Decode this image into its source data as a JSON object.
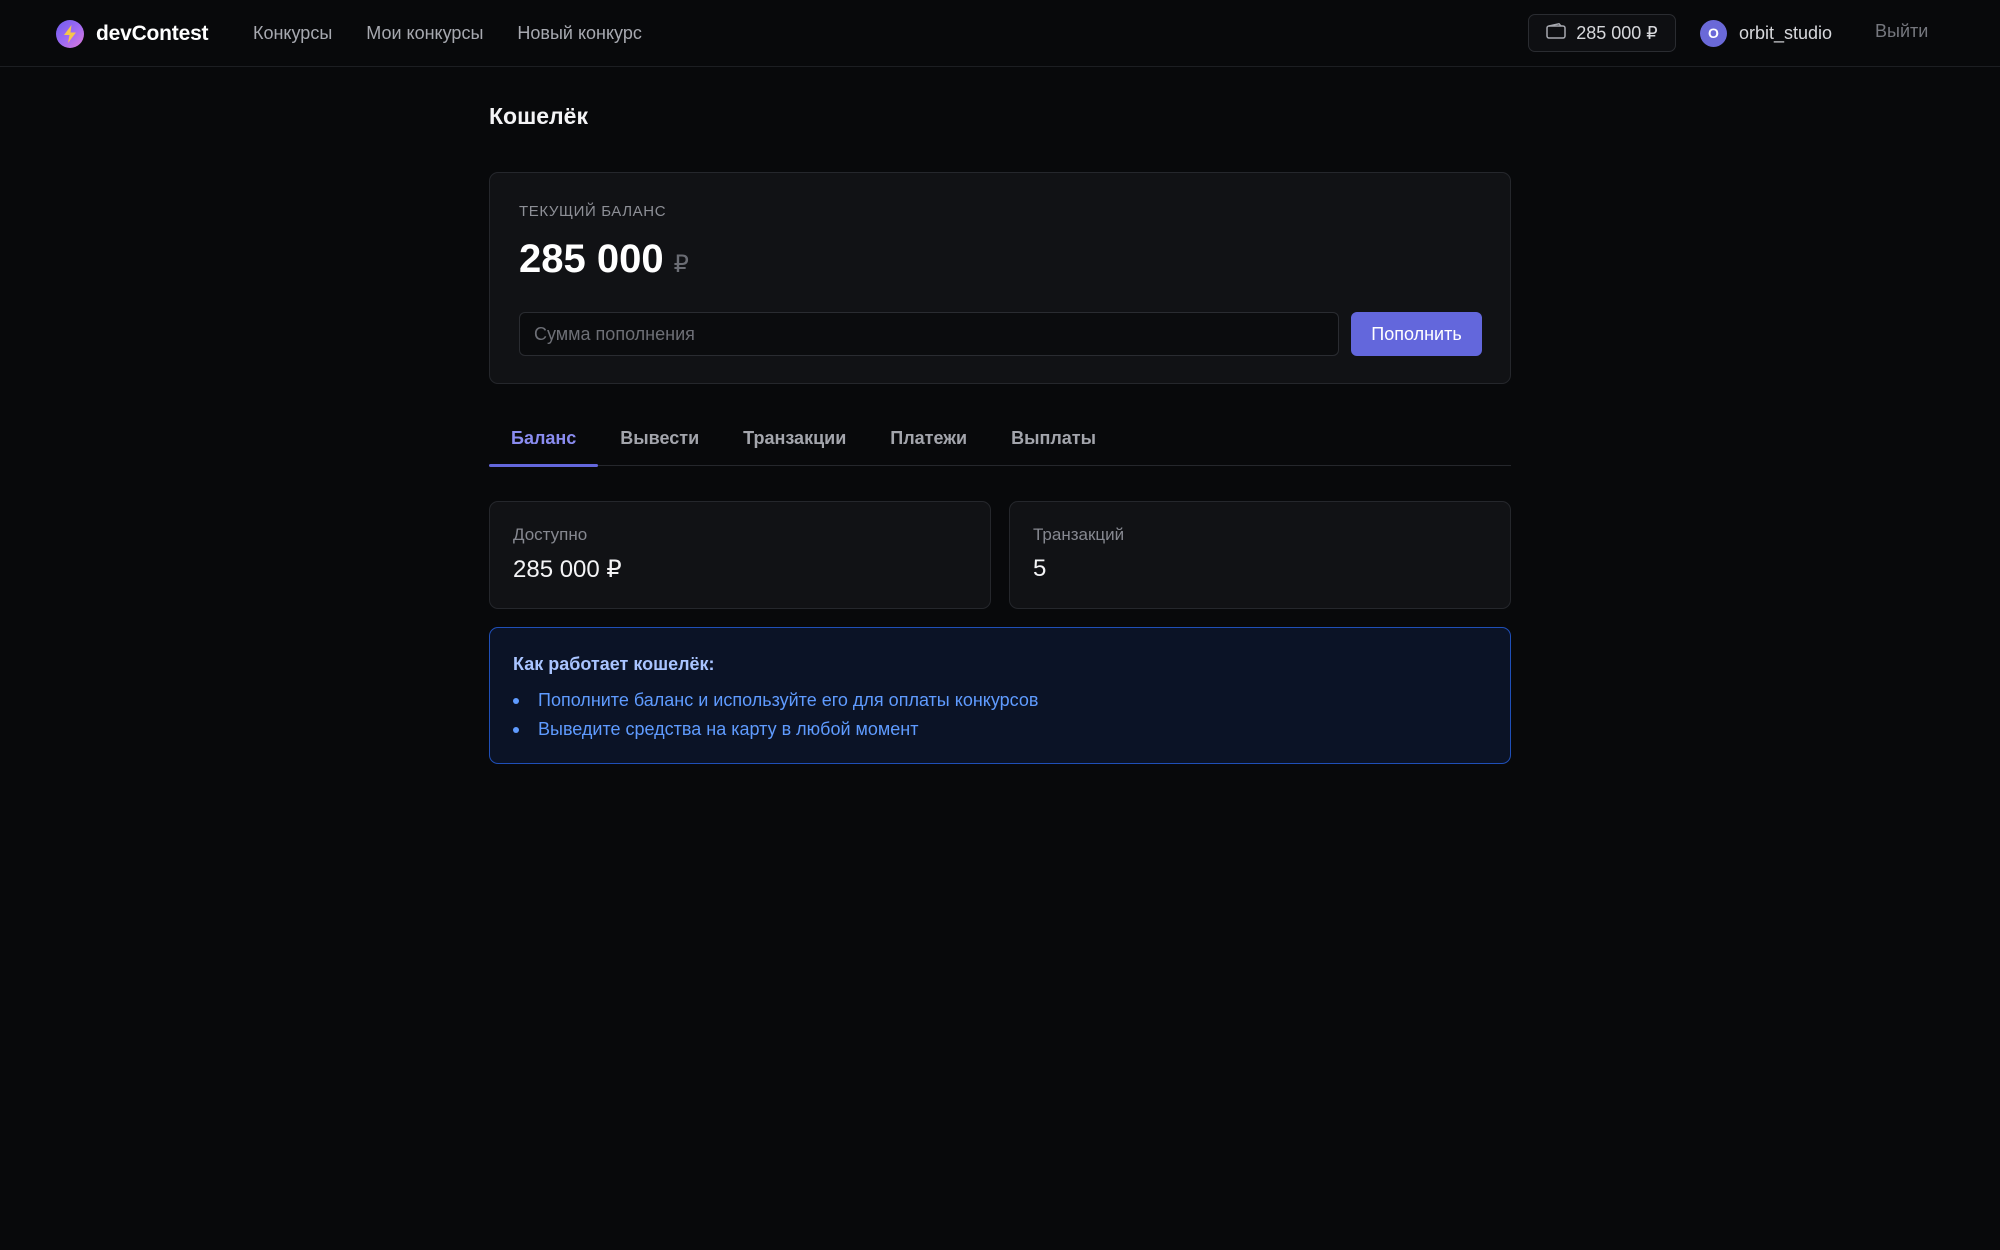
{
  "header": {
    "brand": "devContest",
    "nav": [
      "Конкурсы",
      "Мои конкурсы",
      "Новый конкурс"
    ],
    "wallet_amount": "285 000 ₽",
    "avatar_letter": "O",
    "username": "orbit_studio",
    "logout": "Выйти"
  },
  "page": {
    "title": "Кошелёк"
  },
  "balance": {
    "label": "ТЕКУЩИЙ БАЛАНС",
    "amount": "285 000",
    "currency": "₽",
    "input_placeholder": "Сумма пополнения",
    "topup_button": "Пополнить"
  },
  "tabs": [
    {
      "label": "Баланс",
      "active": true
    },
    {
      "label": "Вывести",
      "active": false
    },
    {
      "label": "Транзакции",
      "active": false
    },
    {
      "label": "Платежи",
      "active": false
    },
    {
      "label": "Выплаты",
      "active": false
    }
  ],
  "stats": {
    "available_label": "Доступно",
    "available_value": "285 000 ₽",
    "transactions_label": "Транзакций",
    "transactions_value": "5"
  },
  "info": {
    "title": "Как работает кошелёк:",
    "items": [
      "Пополните баланс и используйте его для оплаты конкурсов",
      "Выведите средства на карту в любой момент"
    ]
  },
  "colors": {
    "accent": "#6367dc",
    "background": "#08090b",
    "info_border": "#1f4fb8",
    "info_text": "#5f9bff"
  },
  "icons": {
    "logo": "lightning-bolt-icon",
    "wallet": "wallet-icon"
  }
}
